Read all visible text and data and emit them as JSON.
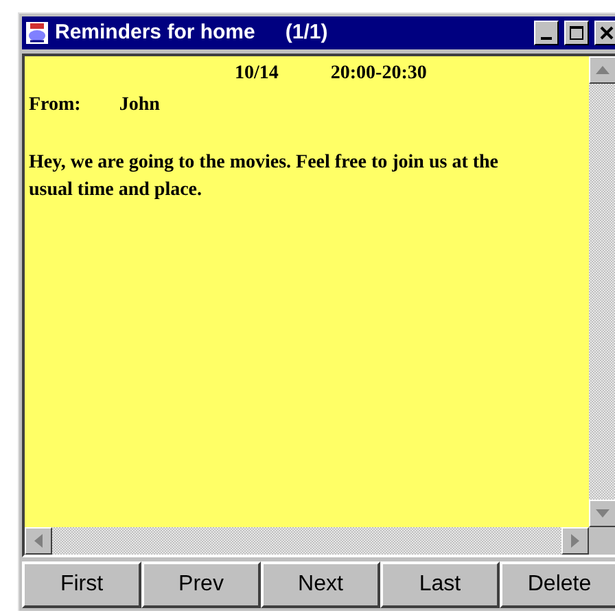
{
  "window": {
    "title": "Reminders for home",
    "counter": "(1/1)"
  },
  "reminder": {
    "date": "10/14",
    "time": "20:00-20:30",
    "from_label": "From:",
    "sender": "John",
    "message": "Hey, we are going to the movies. Feel free to join us at the usual time and place."
  },
  "buttons": [
    "First",
    "Prev",
    "Next",
    "Last",
    "Delete"
  ]
}
